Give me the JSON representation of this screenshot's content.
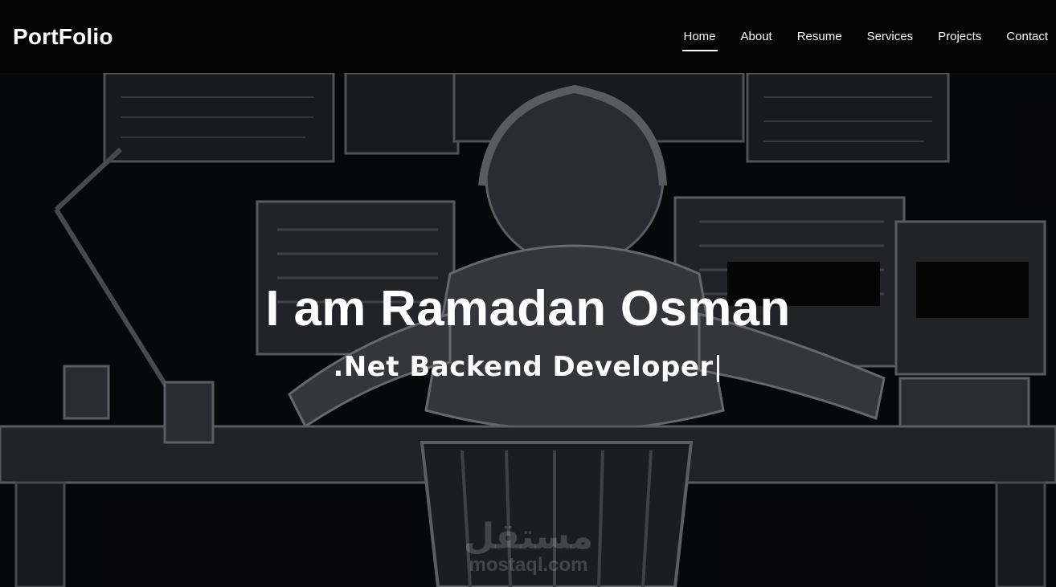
{
  "brand": "PortFolio",
  "nav": {
    "items": [
      {
        "label": "Home",
        "active": true
      },
      {
        "label": "About"
      },
      {
        "label": "Resume"
      },
      {
        "label": "Services"
      },
      {
        "label": "Projects"
      },
      {
        "label": "Contact"
      }
    ]
  },
  "hero": {
    "title": "I am Ramadan Osman",
    "subtitle": ".Net Backend Developer",
    "cursor": "|"
  },
  "watermark": {
    "arabic": "مستقل",
    "latin": "mostaql.com"
  },
  "colors": {
    "navbar": "#030303",
    "text": "#ffffff",
    "hero_bg": "#0b0c0f"
  }
}
